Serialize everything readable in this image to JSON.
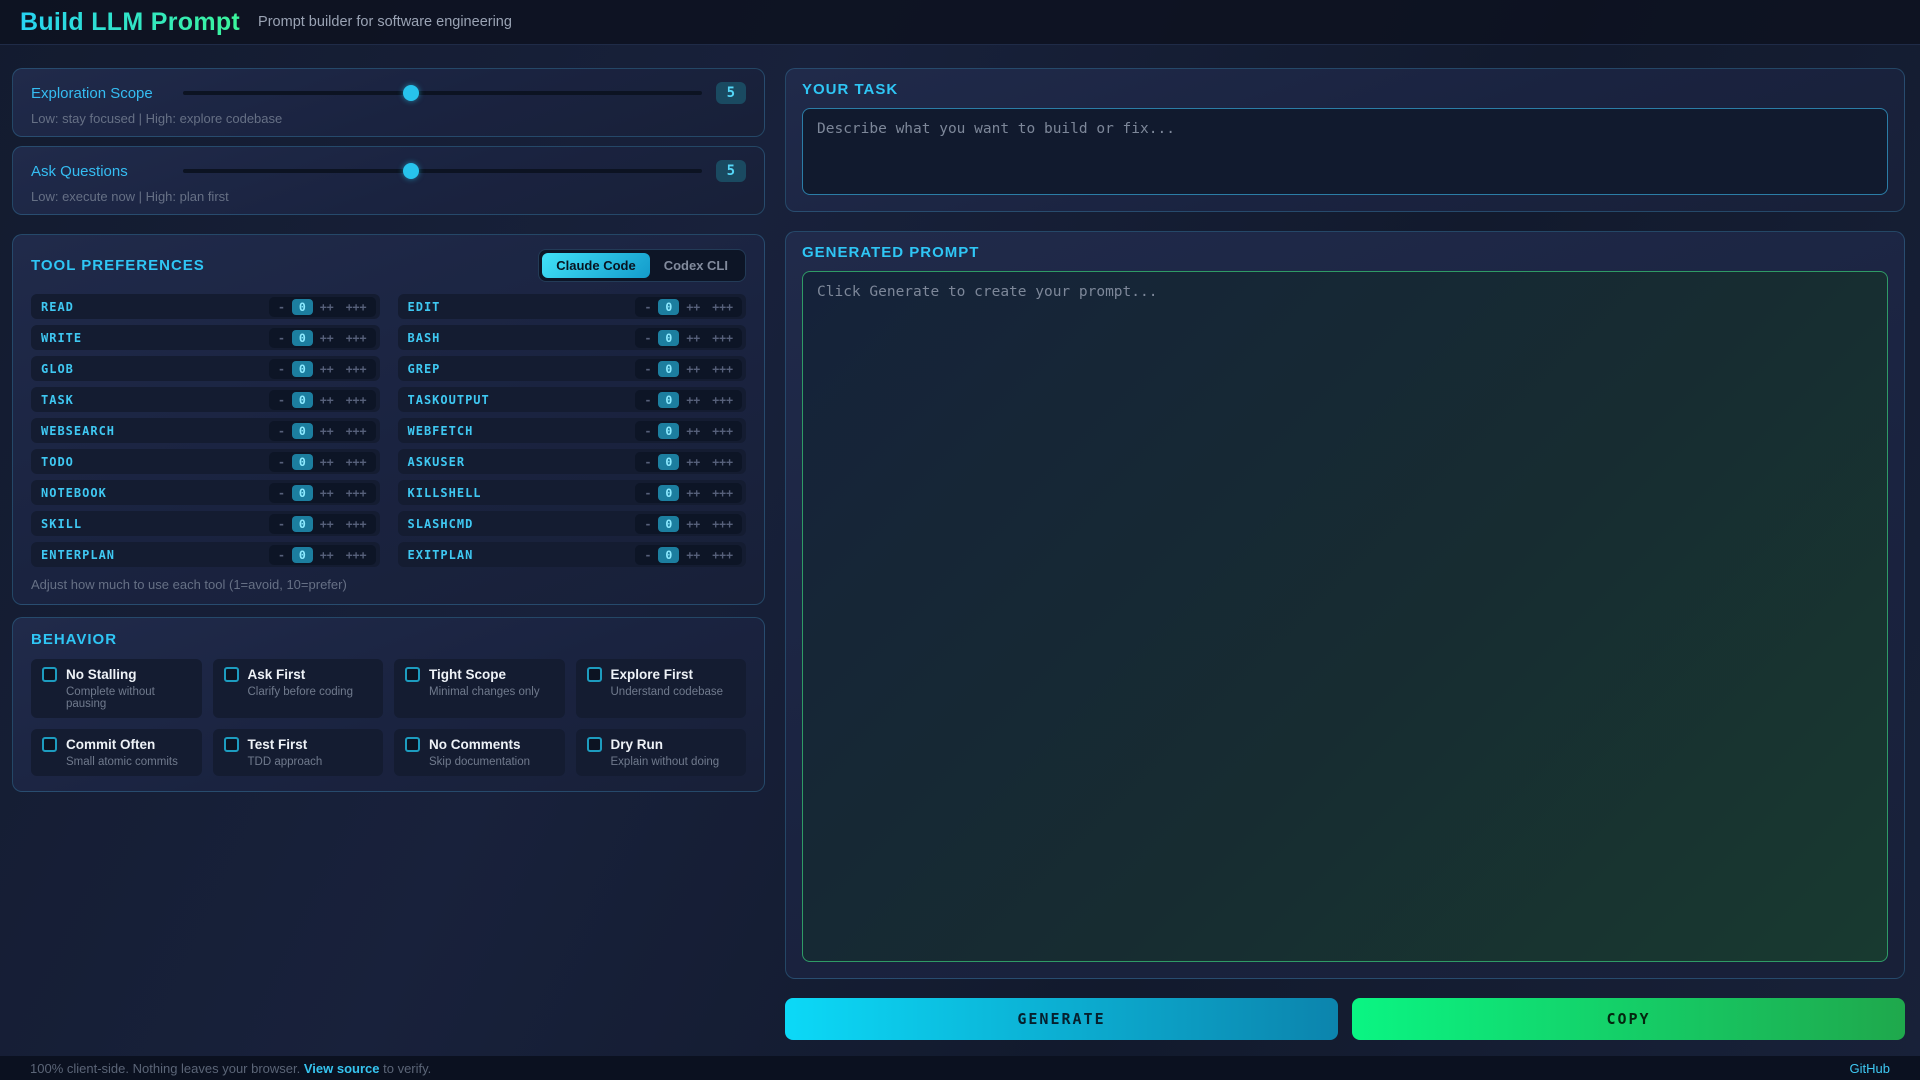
{
  "header": {
    "title": "Build LLM Prompt",
    "subtitle": "Prompt builder for software engineering"
  },
  "sliders": [
    {
      "label": "Exploration Scope",
      "value": "5",
      "percent": 44,
      "caption": "Low: stay focused | High: explore codebase"
    },
    {
      "label": "Ask Questions",
      "value": "5",
      "percent": 44,
      "caption": "Low: execute now | High: plan first"
    }
  ],
  "tools": {
    "title": "TOOL PREFERENCES",
    "toggle": {
      "active": "Claude Code",
      "inactive": "Codex CLI"
    },
    "segments": [
      "-",
      "0",
      "++",
      "+++"
    ],
    "selected_segment": "0",
    "items": [
      "READ",
      "EDIT",
      "WRITE",
      "BASH",
      "GLOB",
      "GREP",
      "TASK",
      "TASKOUTPUT",
      "WEBSEARCH",
      "WEBFETCH",
      "TODO",
      "ASKUSER",
      "NOTEBOOK",
      "KILLSHELL",
      "SKILL",
      "SLASHCMD",
      "ENTERPLAN",
      "EXITPLAN"
    ],
    "caption": "Adjust how much to use each tool (1=avoid, 10=prefer)"
  },
  "behavior": {
    "title": "BEHAVIOR",
    "items": [
      {
        "label": "No Stalling",
        "desc": "Complete without pausing",
        "checked": false
      },
      {
        "label": "Ask First",
        "desc": "Clarify before coding",
        "checked": false
      },
      {
        "label": "Tight Scope",
        "desc": "Minimal changes only",
        "checked": false
      },
      {
        "label": "Explore First",
        "desc": "Understand codebase",
        "checked": false
      },
      {
        "label": "Commit Often",
        "desc": "Small atomic commits",
        "checked": false
      },
      {
        "label": "Test First",
        "desc": "TDD approach",
        "checked": false
      },
      {
        "label": "No Comments",
        "desc": "Skip documentation",
        "checked": false
      },
      {
        "label": "Dry Run",
        "desc": "Explain without doing",
        "checked": false
      }
    ]
  },
  "task": {
    "title": "YOUR TASK",
    "placeholder": "Describe what you want to build or fix..."
  },
  "output": {
    "title": "GENERATED PROMPT",
    "placeholder": "Click Generate to create your prompt..."
  },
  "actions": {
    "generate": "GENERATE",
    "copy": "COPY"
  },
  "footer": {
    "text_before": "100% client-side. Nothing leaves your browser. ",
    "link": "View source",
    "text_after": " to verify.",
    "github": "GitHub"
  },
  "colors": {
    "accent_cyan": "#2fc6f5",
    "accent_green": "#3bf59b",
    "panel_border": "#37a2aa",
    "generate_gradient": [
      "#0cd9f7",
      "#0c84ad"
    ],
    "copy_gradient": [
      "#0af583",
      "#1fa84c"
    ]
  }
}
